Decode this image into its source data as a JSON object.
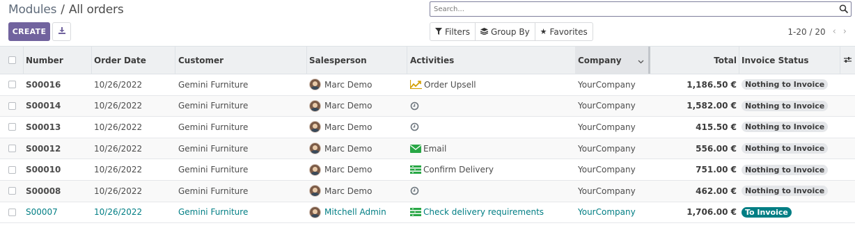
{
  "breadcrumb": {
    "parent": "Modules",
    "separator": "/",
    "current": "All orders"
  },
  "toolbar": {
    "create_label": "CREATE"
  },
  "search": {
    "placeholder": "Search..."
  },
  "filters": {
    "filters_label": "Filters",
    "groupby_label": "Group By",
    "favorites_label": "Favorites"
  },
  "pager": {
    "value": "1-20 / 20"
  },
  "columns": {
    "number": "Number",
    "order_date": "Order Date",
    "customer": "Customer",
    "salesperson": "Salesperson",
    "activities": "Activities",
    "company": "Company",
    "total": "Total",
    "invoice_status": "Invoice Status"
  },
  "rows": [
    {
      "number": "S00016",
      "date": "10/26/2022",
      "customer": "Gemini Furniture",
      "salesperson": "Marc Demo",
      "activity": "Order Upsell",
      "activity_icon": "chart-line-icon",
      "company": "YourCompany",
      "total": "1,186.50 €",
      "status": "Nothing to Invoice"
    },
    {
      "number": "S00014",
      "date": "10/26/2022",
      "customer": "Gemini Furniture",
      "salesperson": "Marc Demo",
      "activity": "",
      "activity_icon": "clock-icon",
      "company": "YourCompany",
      "total": "1,582.00 €",
      "status": "Nothing to Invoice"
    },
    {
      "number": "S00013",
      "date": "10/26/2022",
      "customer": "Gemini Furniture",
      "salesperson": "Marc Demo",
      "activity": "",
      "activity_icon": "clock-icon",
      "company": "YourCompany",
      "total": "415.50 €",
      "status": "Nothing to Invoice"
    },
    {
      "number": "S00012",
      "date": "10/26/2022",
      "customer": "Gemini Furniture",
      "salesperson": "Marc Demo",
      "activity": "Email",
      "activity_icon": "envelope-icon",
      "company": "YourCompany",
      "total": "556.00 €",
      "status": "Nothing to Invoice"
    },
    {
      "number": "S00010",
      "date": "10/26/2022",
      "customer": "Gemini Furniture",
      "salesperson": "Marc Demo",
      "activity": "Confirm Delivery",
      "activity_icon": "tasks-icon",
      "company": "YourCompany",
      "total": "751.00 €",
      "status": "Nothing to Invoice"
    },
    {
      "number": "S00008",
      "date": "10/26/2022",
      "customer": "Gemini Furniture",
      "salesperson": "Marc Demo",
      "activity": "",
      "activity_icon": "clock-icon",
      "company": "YourCompany",
      "total": "462.00 €",
      "status": "Nothing to Invoice"
    },
    {
      "number": "S00007",
      "date": "10/26/2022",
      "customer": "Gemini Furniture",
      "salesperson": "Mitchell Admin",
      "activity": "Check delivery requirements",
      "activity_icon": "tasks-icon",
      "company": "YourCompany",
      "total": "1,706.00 €",
      "status": "To Invoice"
    }
  ],
  "colors": {
    "primary": "#71639e",
    "teal": "#017e84",
    "activity_green": "#28a745",
    "activity_orange": "#d39e00",
    "clock_gray": "#6c757d"
  }
}
